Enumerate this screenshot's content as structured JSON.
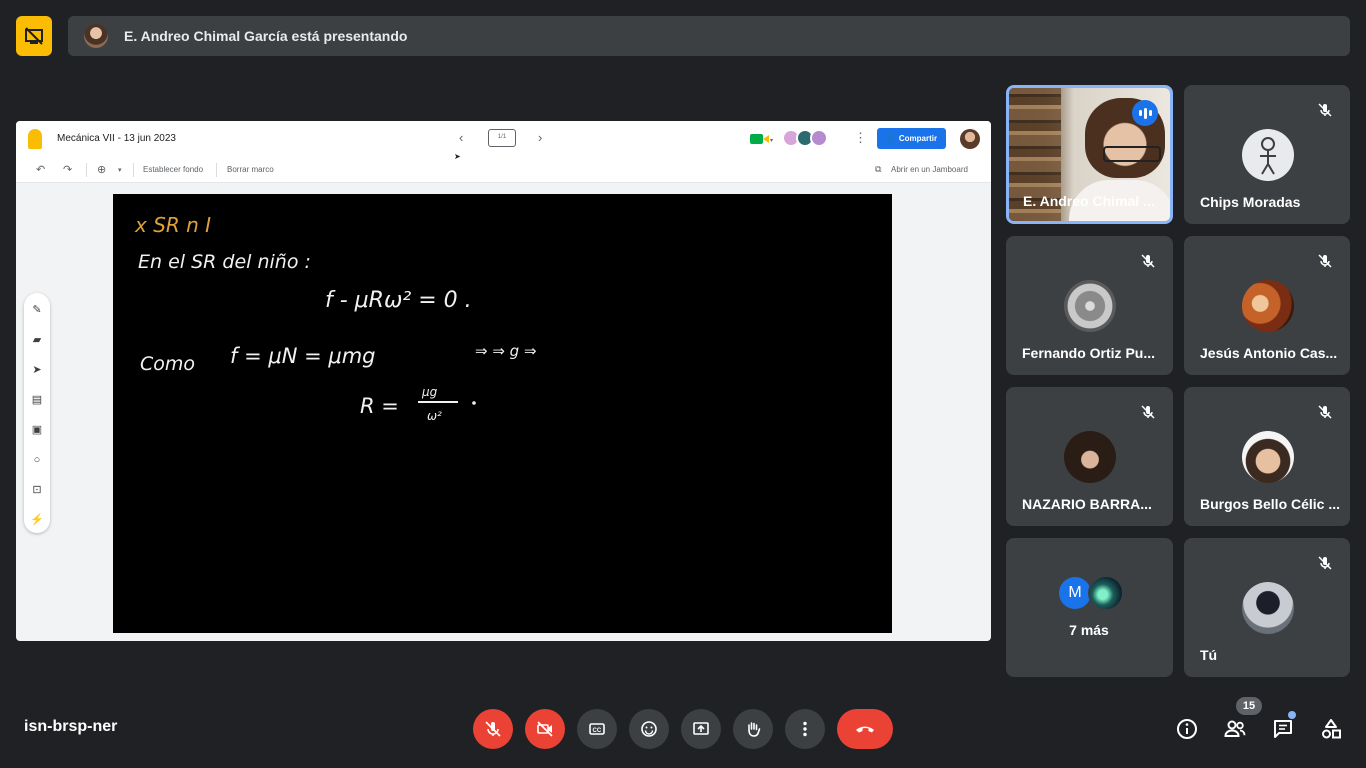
{
  "presenting": {
    "text": "E. Andreo Chimal García está presentando"
  },
  "jamboard": {
    "title": "Mecánica VII - 13 jun 2023",
    "frame_indicator": "1/1",
    "share_label": "Compartir",
    "set_background_label": "Establecer fondo",
    "clear_frame_label": "Borrar marco",
    "open_in_jamboard_label": "Abrir en un Jamboard"
  },
  "board": {
    "line1": "x SR n I",
    "line2": "En el SR del niño :",
    "line3": "f - μRω² = 0 .",
    "line4a": "Como",
    "line4b": "f = μN = μmg",
    "line4c": "⇒ ⇒ g ⇒",
    "line5a": "R =",
    "line5num": "μg",
    "line5den": "ω²"
  },
  "participants": [
    {
      "name": "E. Andreo Chimal ...",
      "speaking": true
    },
    {
      "name": "Chips Moradas",
      "muted": true
    },
    {
      "name": "Fernando Ortiz Pu...",
      "muted": true
    },
    {
      "name": "Jesús Antonio Cas...",
      "muted": true
    },
    {
      "name": "NAZARIO BARRA...",
      "muted": true
    },
    {
      "name": "Burgos Bello Célic ...",
      "muted": true
    },
    {
      "name": "Tú",
      "muted": true
    }
  ],
  "more": {
    "text": "7 más",
    "initial": "M"
  },
  "bottom": {
    "meeting_code": "isn-brsp-ner",
    "participant_count": "15"
  },
  "colors": {
    "background": "#202124",
    "tile": "#3c4043",
    "accent_blue": "#1a73e8",
    "end_call": "#ea4335",
    "stop_presenting": "#fbbc04",
    "board_orange": "#e0a13a"
  },
  "icons": {
    "stop_presenting": "stop-presenting-icon",
    "mic_off": "mic-off-icon",
    "camera_off": "camera-off-icon",
    "captions": "captions-icon",
    "emoji": "emoji-icon",
    "present": "present-icon",
    "raise_hand": "raise-hand-icon",
    "more": "more-options-icon",
    "end_call": "end-call-icon",
    "info": "info-icon",
    "people": "people-icon",
    "chat": "chat-icon",
    "activities": "activities-icon"
  }
}
